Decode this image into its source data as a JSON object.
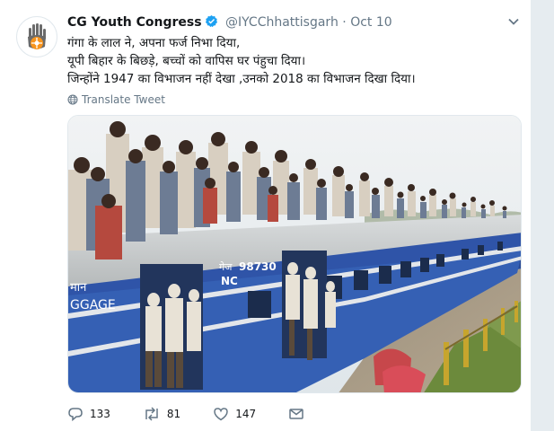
{
  "tweet": {
    "author_name": "CG Youth Congress",
    "handle": "@IYCChhattisgarh",
    "separator": "·",
    "time": "Oct 10",
    "lines": [
      "गंगा के लाल ने, अपना फर्ज निभा दिया,",
      "यूपी बिहार के बिछड़े, बच्चों को वापिस घर पंहुचा दिया।",
      "जिन्होंने 1947 का विभाजन नहीं देखा ,उनको 2018 का विभाजन दिखा दिया।"
    ],
    "translate_label": "Translate Tweet",
    "media_text": {
      "coach_number": "98730",
      "coach_prefix": "NC",
      "coach_label": "गेज",
      "luggage_hindi": "मान",
      "luggage_text": "GGAGE"
    },
    "actions": {
      "replies": "133",
      "retweets": "81",
      "likes": "147"
    }
  },
  "colors": {
    "verified": "#1da1f2",
    "muted": "#657786",
    "train_blue": "#2f54a8",
    "sky": "#e9eef2"
  },
  "icons": [
    "congress-logo-icon",
    "verified-badge-icon",
    "chevron-down-icon",
    "globe-icon",
    "reply-icon",
    "retweet-icon",
    "like-icon",
    "direct-message-icon"
  ]
}
